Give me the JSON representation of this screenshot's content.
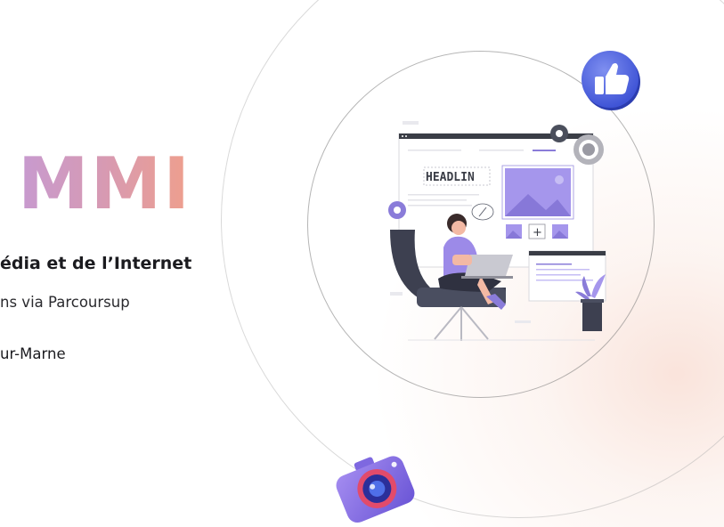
{
  "hero": {
    "title": "MMI",
    "subtitle": "édia et de l’Internet",
    "admission": "ns via Parcoursup",
    "location": "ur-Marne"
  },
  "illustration": {
    "headline_text": "HEADLIN",
    "plus_symbol": "+"
  },
  "colors": {
    "title_gradient_start": "#c79ad0",
    "title_gradient_end": "#ef9f8c",
    "accent_purple": "#8a7cd9",
    "thumbs_badge_blue": "#4d63e0",
    "background_glow": "#f5cdbe"
  },
  "icons": {
    "thumbs_up": "thumbs-up-icon",
    "camera": "camera-icon",
    "gear": "gear-icon"
  }
}
